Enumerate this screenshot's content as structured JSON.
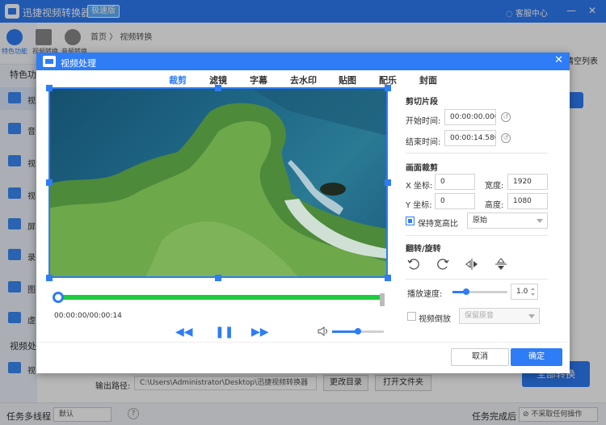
{
  "app": {
    "title": "迅捷视频转换器",
    "badge": "极速版",
    "service": "客服中心",
    "minimize": "—",
    "close": "✕"
  },
  "sidebar": {
    "tools": [
      {
        "label": "特色功能"
      },
      {
        "label": "视频转换"
      },
      {
        "label": "音频转换"
      }
    ],
    "section_label": "特色功",
    "items": [
      {
        "label": "视"
      },
      {
        "label": "音"
      },
      {
        "label": "视"
      },
      {
        "label": "视"
      },
      {
        "label": "屏"
      },
      {
        "label": "录"
      },
      {
        "label": "图"
      },
      {
        "label": "虚"
      }
    ],
    "section_label2": "视频处",
    "item_bottom": {
      "label": "视"
    }
  },
  "breadcrumb": "首页 〉 视频转换",
  "clear_list": "清空列表",
  "big_convert": "全部转换",
  "output": {
    "label": "输出路径:",
    "path": "C:\\Users\\Administrator\\Desktop\\迅捷视频转换器",
    "change_btn": "更改目录",
    "open_btn": "打开文件夹"
  },
  "statusbar": {
    "multi_label": "任务多线程",
    "multi_value": "默认",
    "help": "?",
    "done_label": "任务完成后",
    "done_value": "不采取任何操作"
  },
  "dialog": {
    "title": "视频处理",
    "close": "✕",
    "tabs": [
      {
        "label": "裁剪",
        "active": true
      },
      {
        "label": "滤镜",
        "active": false
      },
      {
        "label": "字幕",
        "active": false
      },
      {
        "label": "去水印",
        "active": false
      },
      {
        "label": "贴图",
        "active": false
      },
      {
        "label": "配乐",
        "active": false
      },
      {
        "label": "封面",
        "active": false
      }
    ],
    "player": {
      "time": "00:00:00/00:00:14",
      "progress": 0,
      "volume": 0.5
    },
    "clip": {
      "title": "剪切片段",
      "start_label": "开始时间:",
      "start_value": "00:00:00.000",
      "end_label": "结束时间:",
      "end_value": "00:00:14.580"
    },
    "crop": {
      "title": "画面裁剪",
      "x_label": "X 坐标:",
      "x_value": "0",
      "w_label": "宽度:",
      "w_value": "1920",
      "y_label": "Y 坐标:",
      "y_value": "0",
      "h_label": "高度:",
      "h_value": "1080",
      "keep_ratio_label": "保持宽高比",
      "keep_ratio_checked": true,
      "ratio_value": "原始"
    },
    "flip": {
      "title": "翻转/旋转",
      "rotate_left": "90°",
      "rotate_right": "90°"
    },
    "speed": {
      "label": "播放速度:",
      "value": "1.0",
      "level": 0.25
    },
    "reverse": {
      "label": "视频倒放",
      "checked": false,
      "audio_value": "保留原音"
    },
    "cancel": "取消",
    "ok": "确定"
  },
  "colors": {
    "accent": "#2e7cf6",
    "timeline": "#1dcc3e"
  }
}
